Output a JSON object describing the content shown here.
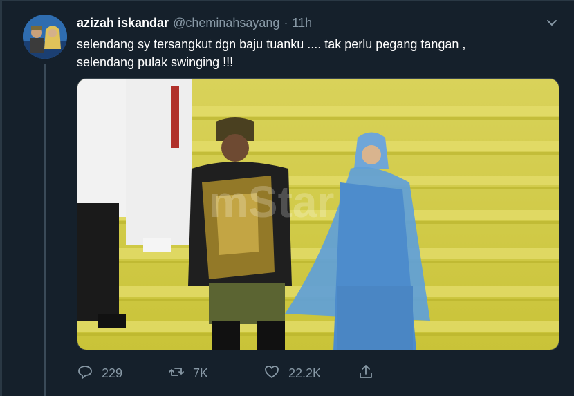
{
  "tweet": {
    "display_name": "azizah iskandar",
    "handle": "@cheminahsayang",
    "separator": "·",
    "time": "11h",
    "text_line1": "selendang sy tersangkut dgn baju tuanku .... tak perlu pegang tangan ,",
    "text_line2": "selendang pulak swinging !!!",
    "media_watermark": "mStar"
  },
  "actions": {
    "reply": {
      "icon": "reply-icon",
      "count": "229"
    },
    "retweet": {
      "icon": "retweet-icon",
      "count": "7K"
    },
    "like": {
      "icon": "heart-icon",
      "count": "22.2K"
    },
    "share": {
      "icon": "share-icon"
    }
  },
  "colors": {
    "background": "#15202b",
    "secondary_text": "#8899a6",
    "primary_text": "#ffffff"
  }
}
